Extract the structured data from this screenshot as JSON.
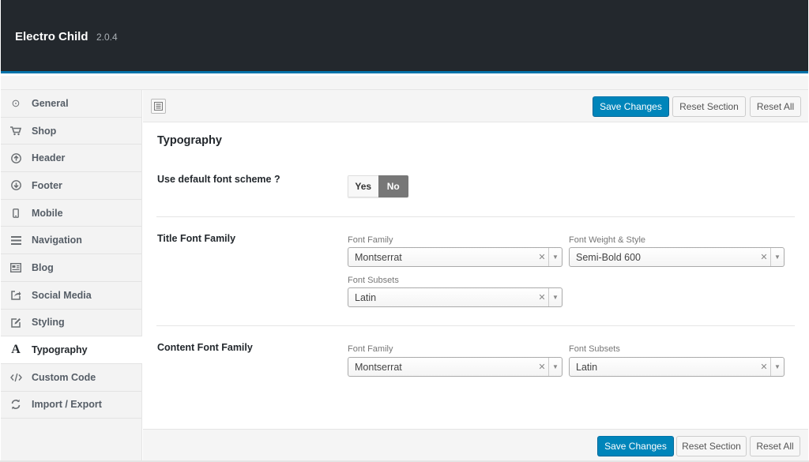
{
  "header": {
    "title": "Electro Child",
    "version": "2.0.4"
  },
  "sidebar": {
    "items": [
      {
        "label": "General",
        "icon": "info-circle-icon",
        "glyph": "⊙"
      },
      {
        "label": "Shop",
        "icon": "cart-icon",
        "glyph": "🛒"
      },
      {
        "label": "Header",
        "icon": "arrow-up-circle-icon",
        "glyph": "⬆"
      },
      {
        "label": "Footer",
        "icon": "arrow-down-circle-icon",
        "glyph": "⬇"
      },
      {
        "label": "Mobile",
        "icon": "smartphone-icon",
        "glyph": "▯"
      },
      {
        "label": "Navigation",
        "icon": "menu-icon",
        "glyph": "☰"
      },
      {
        "label": "Blog",
        "icon": "newspaper-icon",
        "glyph": "▤"
      },
      {
        "label": "Social Media",
        "icon": "share-icon",
        "glyph": "↗"
      },
      {
        "label": "Styling",
        "icon": "edit-icon",
        "glyph": "✎"
      },
      {
        "label": "Typography",
        "icon": "typography-icon",
        "glyph": "A",
        "active": true
      },
      {
        "label": "Custom Code",
        "icon": "code-icon",
        "glyph": "</>"
      },
      {
        "label": "Import / Export",
        "icon": "refresh-icon",
        "glyph": "⟳"
      }
    ]
  },
  "toolbar": {
    "save_label": "Save Changes",
    "reset_section_label": "Reset Section",
    "reset_all_label": "Reset All"
  },
  "footer": {
    "save_label": "Save Changes",
    "reset_section_label": "Reset Section",
    "reset_all_label": "Reset All"
  },
  "section": {
    "title": "Typography",
    "default_scheme": {
      "label": "Use default font scheme ?",
      "yes": "Yes",
      "no": "No",
      "selected": "No"
    },
    "title_font": {
      "label": "Title Font Family",
      "family_label": "Font Family",
      "family_value": "Montserrat",
      "weight_label": "Font Weight & Style",
      "weight_value": "Semi-Bold 600",
      "subsets_label": "Font Subsets",
      "subsets_value": "Latin"
    },
    "content_font": {
      "label": "Content Font Family",
      "family_label": "Font Family",
      "family_value": "Montserrat",
      "subsets_label": "Font Subsets",
      "subsets_value": "Latin"
    }
  },
  "colors": {
    "header_bg": "#23282d",
    "accent": "#0085ba",
    "header_border": "#0073aa"
  }
}
